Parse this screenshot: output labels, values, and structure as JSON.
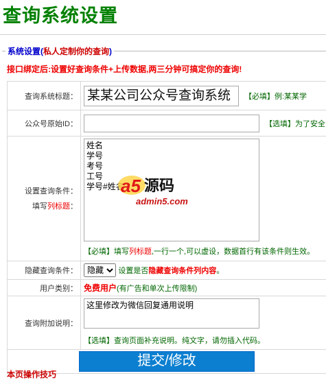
{
  "page": {
    "title": "查询系统设置"
  },
  "section": {
    "legend_prefix": "系统设置(",
    "legend_highlight": "私人定制你的查询",
    "legend_suffix": ")"
  },
  "tip": "接口绑定后:设置好查询条件+上传数据,两三分钟可搞定你的查询!",
  "form": {
    "title_label": "查询系统标题：",
    "title_value": "某某公司公众号查询系统",
    "title_hint_tag": "【必填】",
    "title_hint": "例:某某学",
    "wxid_label": "公众号原始ID：",
    "wxid_value": "",
    "wxid_hint_tag": "【选填】",
    "wxid_hint": "为了安全",
    "cond_label_1": "设置查询条件：",
    "cond_label_2_prefix": "填写",
    "cond_label_2_red": "列标题",
    "cond_label_2_suffix": "：",
    "cond_value": "姓名\n学号\n考号\n工号\n学号#姓名",
    "cond_hint_tag": "【必填】",
    "cond_hint_pre": "填写",
    "cond_hint_red": "列标题",
    "cond_hint_post": ",一行一个,可以虚设，数据首行有该条件则生效。",
    "hide_label": "隐藏查询条件：",
    "hide_selected": "隐藏",
    "hide_hint_pre": "设置是否",
    "hide_hint_red": "隐藏查询条件列内容",
    "hide_hint_post": "。",
    "user_label": "用户类别：",
    "user_type": "免费用户",
    "user_note": "(有广告和单次上传限制)",
    "note_label": "查询附加说明：",
    "note_value": "这里修改为微信回复通用说明",
    "note_hint_tag": "【选填】",
    "note_hint": "查询页面补充说明。纯文字，请勿插入代码。",
    "submit_label": "提交/修改"
  },
  "footer": {
    "tips_link": "本页操作技巧"
  },
  "watermark": {
    "brand": "a5源码",
    "domain": "admin5.com"
  }
}
